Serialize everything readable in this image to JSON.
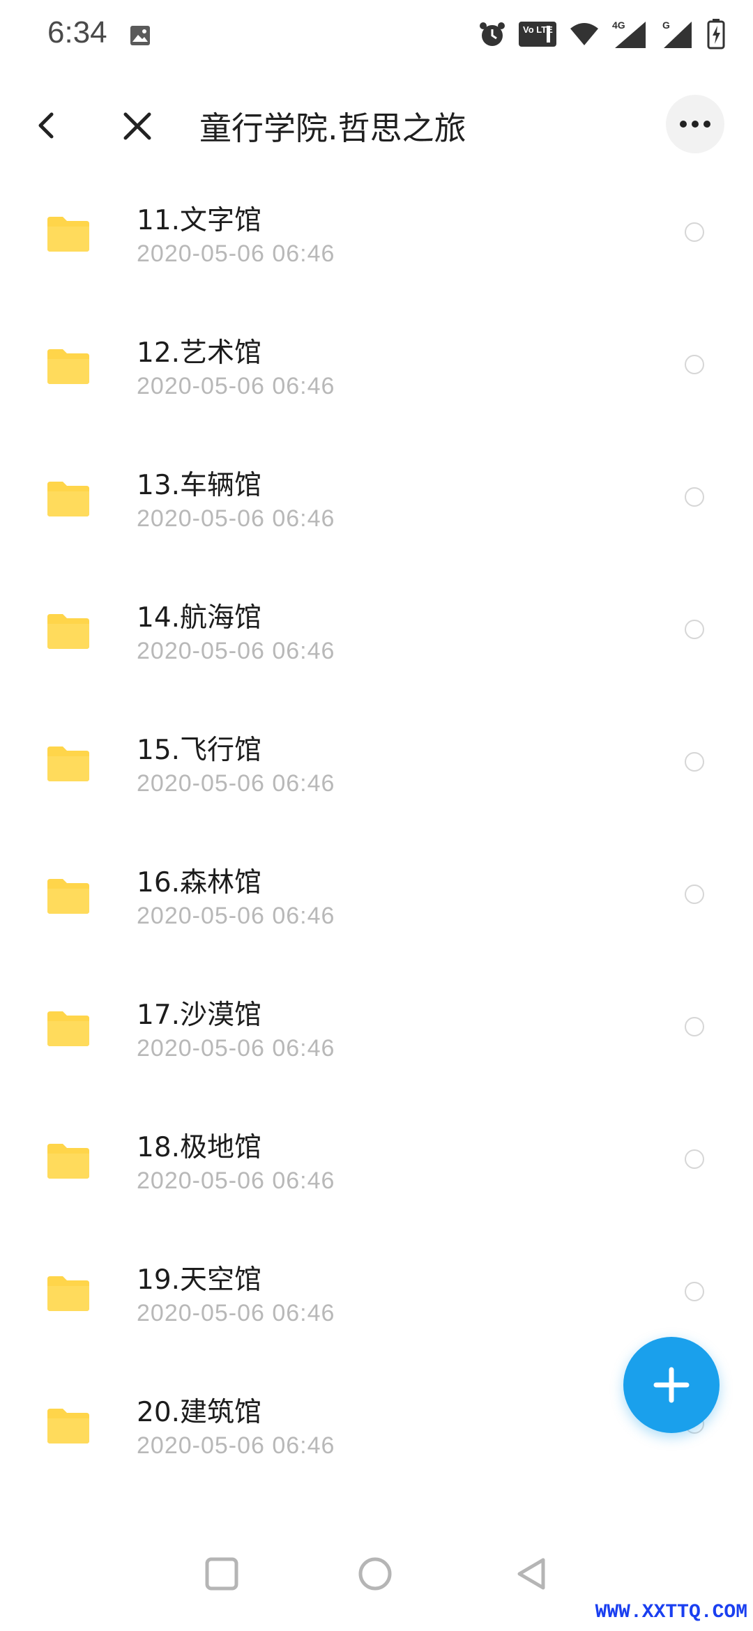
{
  "status_bar": {
    "time": "6:34",
    "icons": [
      "image-icon",
      "alarm-icon",
      "volte-icon",
      "wifi-icon",
      "signal-4g-icon",
      "signal-g-icon",
      "battery-charging-icon"
    ],
    "volte_label": "Vo LTE",
    "net_4g": "4G",
    "net_g": "G"
  },
  "header": {
    "title": "童行学院.哲思之旅"
  },
  "files": [
    {
      "name": "11.文字馆",
      "date": "2020-05-06  06:46"
    },
    {
      "name": "12.艺术馆",
      "date": "2020-05-06  06:46"
    },
    {
      "name": "13.车辆馆",
      "date": "2020-05-06  06:46"
    },
    {
      "name": "14.航海馆",
      "date": "2020-05-06  06:46"
    },
    {
      "name": "15.飞行馆",
      "date": "2020-05-06  06:46"
    },
    {
      "name": "16.森林馆",
      "date": "2020-05-06  06:46"
    },
    {
      "name": "17.沙漠馆",
      "date": "2020-05-06  06:46"
    },
    {
      "name": "18.极地馆",
      "date": "2020-05-06  06:46"
    },
    {
      "name": "19.天空馆",
      "date": "2020-05-06  06:46"
    },
    {
      "name": "20.建筑馆",
      "date": "2020-05-06  06:46"
    }
  ],
  "colors": {
    "folder": "#FFD54A",
    "fab": "#1AA0EC",
    "date_text": "#B8B8B8"
  },
  "watermark": "WWW.XXTTQ.COM"
}
